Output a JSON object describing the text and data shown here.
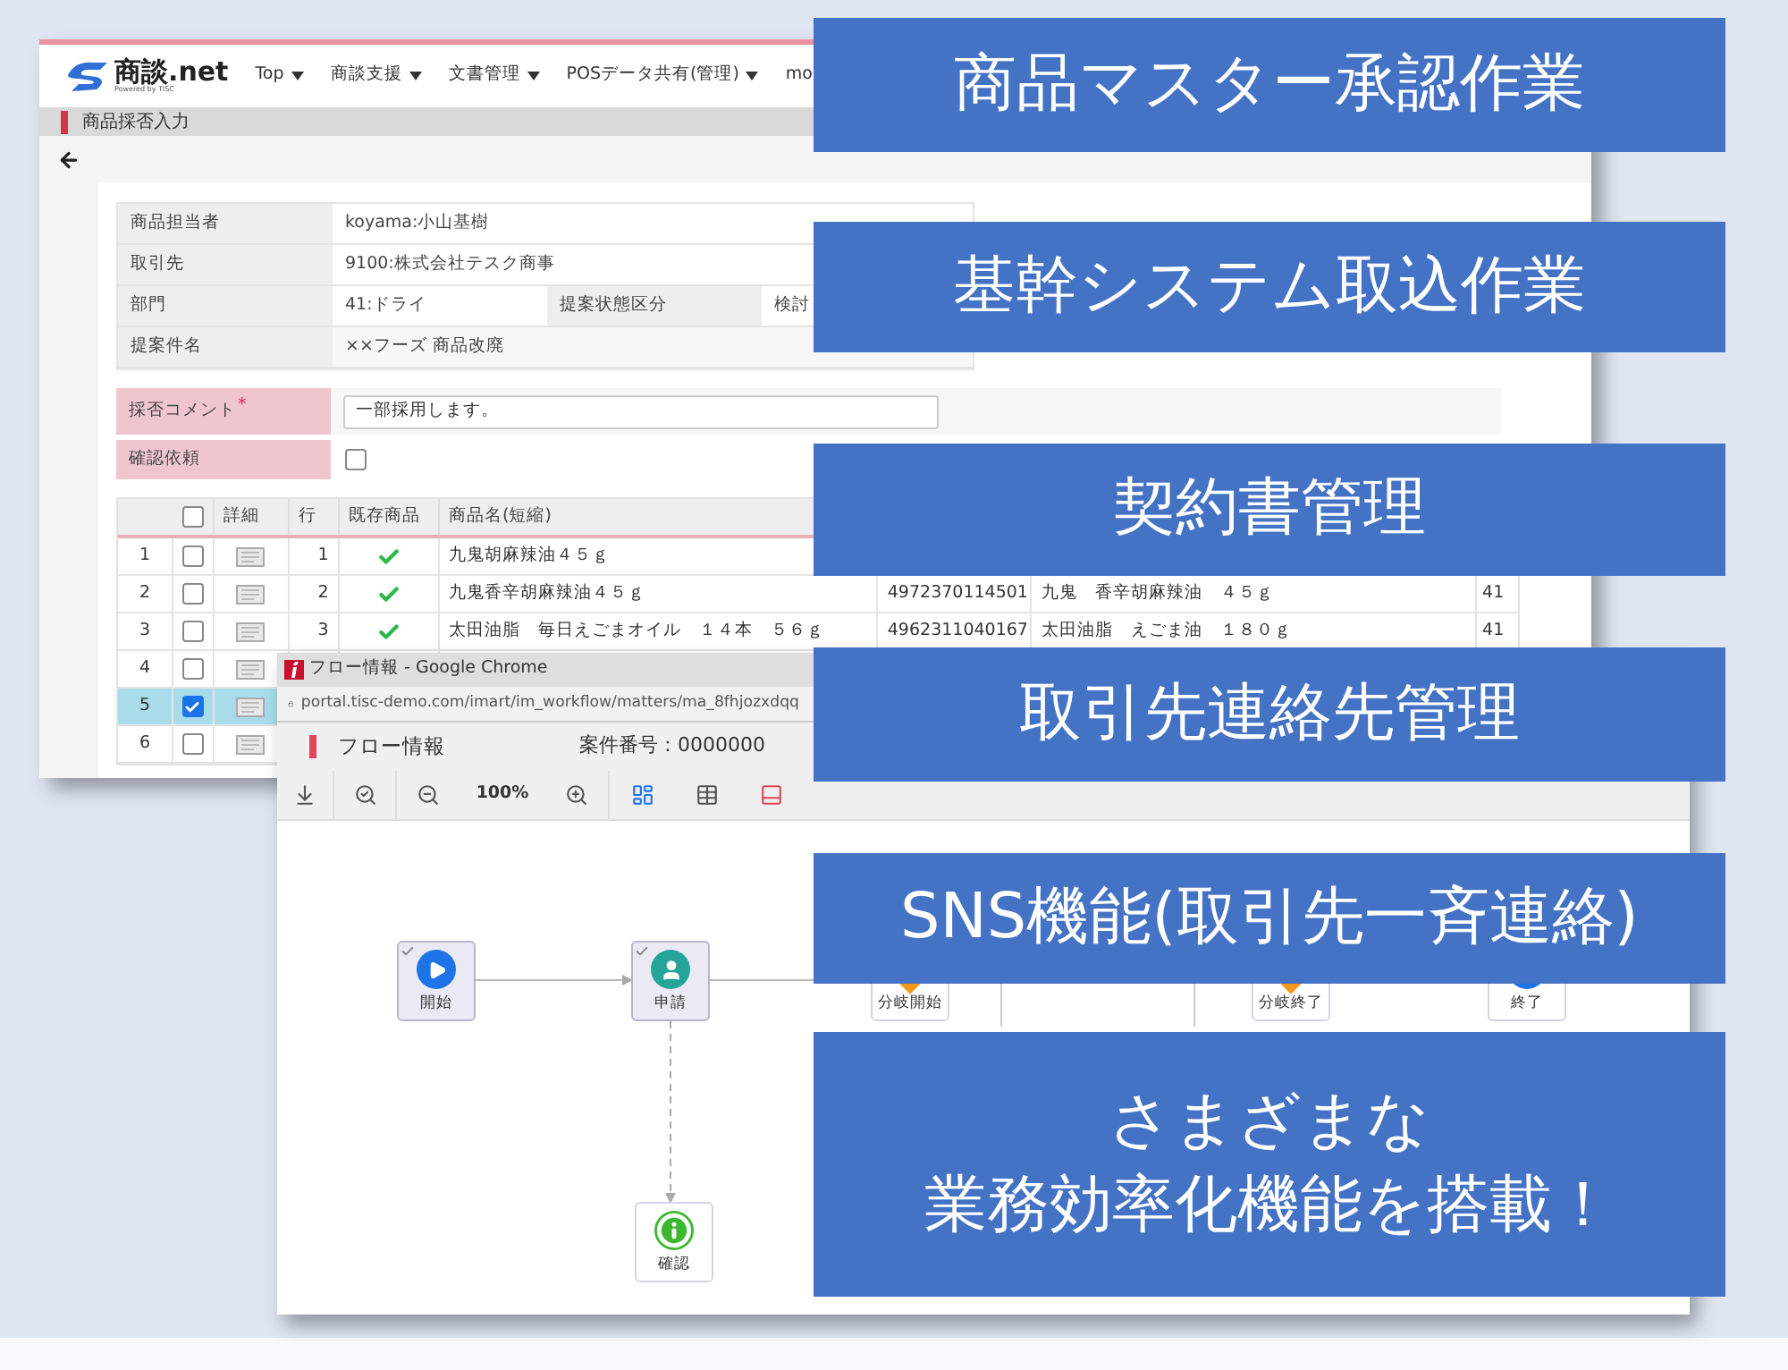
{
  "app_window": {
    "logo": "商談.net",
    "logo_sub": "Powered by TISC",
    "nav": [
      {
        "label": "Top",
        "dropdown": true
      },
      {
        "label": "商談支援",
        "dropdown": true
      },
      {
        "label": "文書管理",
        "dropdown": true
      },
      {
        "label": "POSデータ共有(管理)",
        "dropdown": true
      },
      {
        "label": "mo",
        "dropdown": false
      }
    ],
    "page_title": "商品採否入力",
    "form": [
      {
        "label": "商品担当者",
        "value": "koyama:小山基樹"
      },
      {
        "label": "取引先",
        "value": "9100:株式会社テスク商事"
      },
      {
        "label": "部門",
        "value": "41:ドライ",
        "label_2": "提案状態区分",
        "value_2": "検討"
      },
      {
        "label": "提案件名",
        "value": "××フーズ 商品改廃"
      }
    ],
    "comment": {
      "label": "採否コメント",
      "required_mark": "*",
      "value": "一部採用します。"
    },
    "confirm": {
      "label": "確認依頼",
      "checked": false
    },
    "table": {
      "header_checked": false,
      "columns": [
        "詳細",
        "行",
        "既存商品",
        "商品名(短縮)"
      ],
      "rows": [
        {
          "no": "1",
          "checked": false,
          "selected": false,
          "line": "1",
          "existing": true,
          "name": "九鬼胡麻辣油４５ｇ"
        },
        {
          "no": "2",
          "checked": false,
          "selected": false,
          "line": "2",
          "existing": true,
          "name": "九鬼香辛胡麻辣油４５ｇ",
          "jan": "4972370114501",
          "name_2": "九鬼　香辛胡麻辣油　４５ｇ",
          "column_9": "41"
        },
        {
          "no": "3",
          "checked": false,
          "selected": false,
          "line": "3",
          "existing": true,
          "name": "太田油脂　毎日えごまオイル　１４本　５６ｇ",
          "jan": "4962311040167",
          "name_2": "太田油脂　えごま油　１８０ｇ",
          "column_9": "41"
        },
        {
          "no": "4",
          "checked": false,
          "selected": false
        },
        {
          "no": "5",
          "checked": true,
          "selected": true
        },
        {
          "no": "6",
          "checked": false,
          "selected": false
        }
      ]
    }
  },
  "flow_window": {
    "title": "フロー情報 - Google Chrome",
    "url": "portal.tisc-demo.com/imart/im_workflow/matters/ma_8fhjozxdqq",
    "heading": "フロー情報",
    "case_number": "案件番号：0000000",
    "zoom": "100%",
    "nodes": [
      {
        "label": "開始",
        "kind": "start",
        "done": true
      },
      {
        "label": "申請",
        "kind": "user",
        "done": true
      },
      {
        "label": "分岐開始",
        "kind": "branch",
        "done": false
      },
      {
        "label": "分岐終了",
        "kind": "branch",
        "done": false
      },
      {
        "label": "終了",
        "kind": "end",
        "done": false
      },
      {
        "label": "確認",
        "kind": "info",
        "done": false
      }
    ]
  },
  "banners": [
    {
      "text": "商品マスター承認作業"
    },
    {
      "text": "基幹システム取込作業"
    },
    {
      "text": "契約書管理"
    },
    {
      "text": "取引先連絡先管理"
    },
    {
      "text": "SNS機能(取引先一斉連絡)"
    },
    {
      "lines": [
        "さまざまな",
        "業務効率化機能を搭載！"
      ]
    }
  ]
}
